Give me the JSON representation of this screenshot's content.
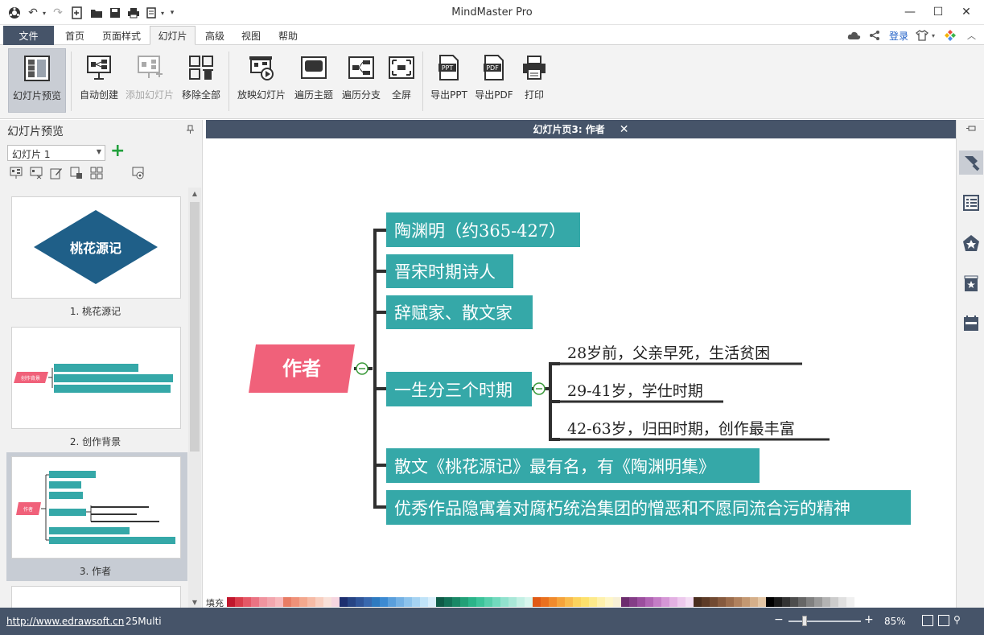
{
  "app": {
    "title": "MindMaster Pro"
  },
  "window": {
    "minimize": "—",
    "maximize": "☐",
    "close": "✕"
  },
  "menu": {
    "file": "文件",
    "tabs": [
      "首页",
      "页面样式",
      "幻灯片",
      "高级",
      "视图",
      "帮助"
    ],
    "active_tab": "幻灯片",
    "login": "登录"
  },
  "ribbon": {
    "buttons": [
      {
        "label": "幻灯片预览",
        "selected": true
      },
      {
        "label": "自动创建"
      },
      {
        "label": "添加幻灯片",
        "disabled": true
      },
      {
        "label": "移除全部"
      },
      {
        "label": "放映幻灯片"
      },
      {
        "label": "遍历主题"
      },
      {
        "label": "遍历分支"
      },
      {
        "label": "全屏"
      },
      {
        "label": "导出PPT"
      },
      {
        "label": "导出PDF"
      },
      {
        "label": "打印"
      }
    ],
    "ppt_badge": "PPT",
    "pdf_badge": "PDF"
  },
  "left_panel": {
    "title": "幻灯片预览",
    "slide_select": "幻灯片 1",
    "slides": [
      {
        "caption": "1. 桃花源记",
        "title": "桃花源记"
      },
      {
        "caption": "2. 创作背景",
        "title": "创作背景"
      },
      {
        "caption": "3. 作者",
        "title": "作者",
        "selected": true
      }
    ]
  },
  "canvas": {
    "header": "幻灯片页3: 作者",
    "close": "✕",
    "mindmap": {
      "root": "作者",
      "branches": [
        "陶渊明（约365-427）",
        "晋宋时期诗人",
        "辞赋家、散文家",
        "一生分三个时期",
        "散文《桃花源记》最有名，有《陶渊明集》",
        "优秀作品隐寓着对腐朽统治集团的憎恶和不愿同流合污的精神"
      ],
      "sub_branches": [
        "28岁前，父亲早死，生活贫困",
        "29-41岁，学仕时期",
        "42-63岁，归田时期，创作最丰富"
      ],
      "colors": {
        "root": "#f0617a",
        "branch": "#35a8a8",
        "line": "#2f2f2f"
      }
    }
  },
  "color_strip": {
    "label": "填充",
    "colors": [
      "#c0172d",
      "#d93b4a",
      "#e55867",
      "#ea7383",
      "#f0949f",
      "#f2a6ae",
      "#f7b9bd",
      "#e87c64",
      "#ef9179",
      "#f3a88e",
      "#f6bba6",
      "#f8cfc0",
      "#f9e1d9",
      "#f6d6e0",
      "#1d2f6f",
      "#264484",
      "#2f5599",
      "#3868ae",
      "#2d7ac0",
      "#3c8ad2",
      "#5a9fdc",
      "#74b1e4",
      "#8dc3ec",
      "#a6d3f2",
      "#c0e3f8",
      "#d8eefb",
      "#0e5b47",
      "#137157",
      "#198866",
      "#22a077",
      "#2ab489",
      "#3cc39a",
      "#57cfac",
      "#72dabe",
      "#91e2ce",
      "#a9e8d8",
      "#c3f0e4",
      "#d8f6ee",
      "#e05a16",
      "#e9701f",
      "#f08a2c",
      "#f5a33b",
      "#f9bb4d",
      "#fcd35e",
      "#fde16d",
      "#fdea8b",
      "#fef1ac",
      "#fef6c8",
      "#f7f0d6",
      "#6c2d6e",
      "#843d87",
      "#9b4e9e",
      "#b064b3",
      "#c47dc6",
      "#d597d6",
      "#e3b1e3",
      "#edc9ed",
      "#f4def4",
      "#4a2e1e",
      "#5d3b27",
      "#714a32",
      "#865a3e",
      "#9b6c4c",
      "#b0815e",
      "#c39872",
      "#d5af8a",
      "#e3c6a5",
      "#000000",
      "#1a1a1a",
      "#333333",
      "#4d4d4d",
      "#666666",
      "#808080",
      "#999999",
      "#b3b3b3",
      "#cccccc",
      "#e0e0e0",
      "#f0f0f0",
      "#ffffff"
    ]
  },
  "status": {
    "link": "http://www.edrawsoft.cn",
    "multi": "25Multi",
    "zoom_minus": "−",
    "zoom_plus": "+",
    "zoom": "85%",
    "zoom_level": 0.2
  }
}
